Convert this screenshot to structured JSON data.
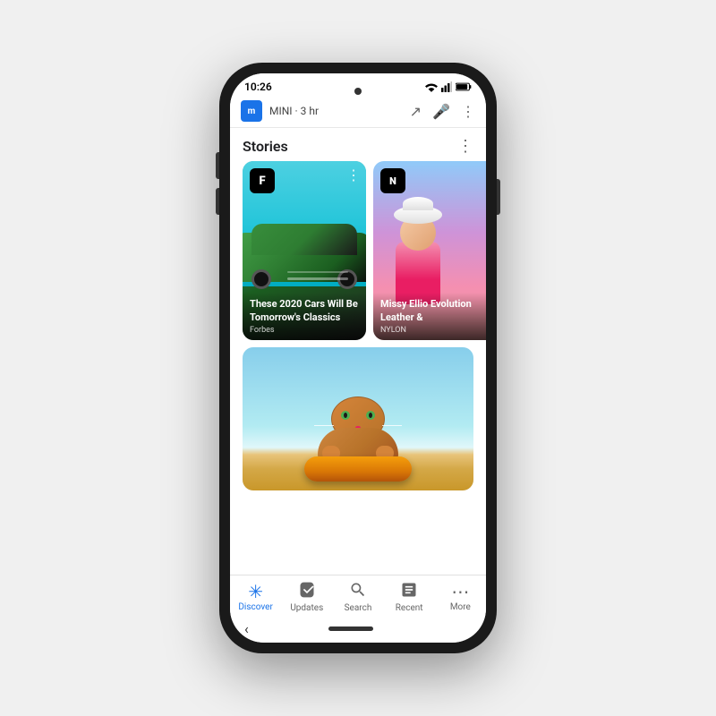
{
  "phone": {
    "status": {
      "time": "10:26"
    },
    "notification": {
      "app": "m",
      "app_name": "MINI",
      "time_ago": "3 hr"
    },
    "stories": {
      "title": "Stories",
      "cards": [
        {
          "id": "forbes",
          "badge": "F",
          "headline": "These 2020 Cars Will Be Tomorrow's Classics",
          "source": "Forbes"
        },
        {
          "id": "nylon",
          "badge": "N",
          "headline": "Missy Ellio Evolution Leather &",
          "source": "NYLON"
        }
      ]
    },
    "nav": {
      "items": [
        {
          "id": "discover",
          "label": "Discover",
          "active": true
        },
        {
          "id": "updates",
          "label": "Updates",
          "active": false
        },
        {
          "id": "search",
          "label": "Search",
          "active": false
        },
        {
          "id": "recent",
          "label": "Recent",
          "active": false
        },
        {
          "id": "more",
          "label": "More",
          "active": false
        }
      ]
    }
  }
}
